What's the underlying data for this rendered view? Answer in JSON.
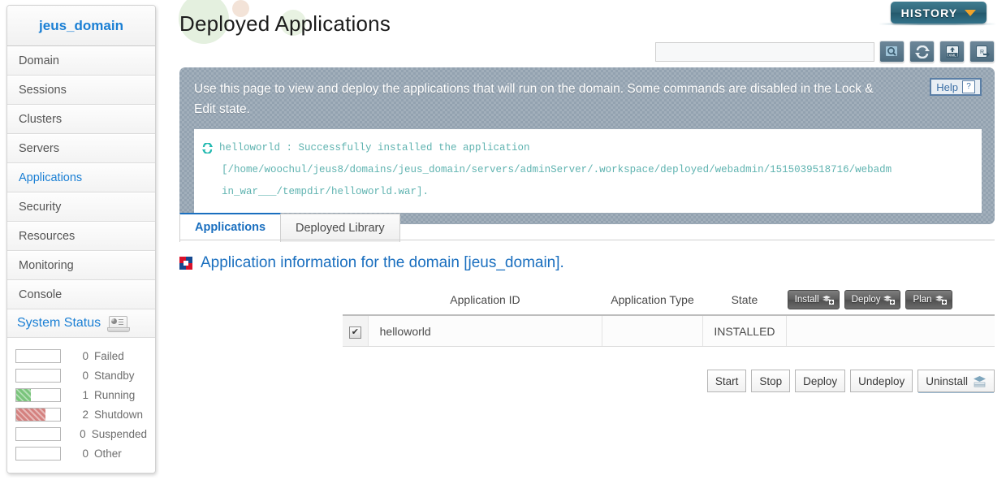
{
  "sidebar": {
    "domain_title": "jeus_domain",
    "items": [
      {
        "label": "Domain"
      },
      {
        "label": "Sessions"
      },
      {
        "label": "Clusters"
      },
      {
        "label": "Servers"
      },
      {
        "label": "Applications"
      },
      {
        "label": "Security"
      },
      {
        "label": "Resources"
      },
      {
        "label": "Monitoring"
      },
      {
        "label": "Console"
      }
    ],
    "system_status": {
      "title": "System Status",
      "icon": "laptop-chart-icon",
      "rows": [
        {
          "count": "0",
          "label": "Failed",
          "fill_pct": 0,
          "color": ""
        },
        {
          "count": "0",
          "label": "Standby",
          "fill_pct": 0,
          "color": ""
        },
        {
          "count": "1",
          "label": "Running",
          "fill_pct": 33,
          "color": "#79c47b"
        },
        {
          "count": "2",
          "label": "Shutdown",
          "fill_pct": 66,
          "color": "#d4817f"
        },
        {
          "count": "0",
          "label": "Suspended",
          "fill_pct": 0,
          "color": ""
        },
        {
          "count": "0",
          "label": "Other",
          "fill_pct": 0,
          "color": ""
        }
      ]
    }
  },
  "header": {
    "page_title": "Deployed Applications",
    "history_label": "HISTORY",
    "history_chevron": "chevron-down-icon",
    "search": {
      "value": "",
      "placeholder": ""
    },
    "toolbar_icons": [
      {
        "name": "search-icon"
      },
      {
        "name": "refresh-icon"
      },
      {
        "name": "xml-export-icon"
      },
      {
        "name": "report-export-icon"
      }
    ]
  },
  "banner": {
    "text": "Use this page to view and deploy the applications that will run on the domain. Some commands are disabled in the Lock & Edit state.",
    "help_label": "Help",
    "help_glyph": "?",
    "message": {
      "icon": "refresh-status-icon",
      "line1": "helloworld : Successfully installed the application",
      "line2": "[/home/woochul/jeus8/domains/jeus_domain/servers/adminServer/.workspace/deployed/webadmin/1515039518716/webadm",
      "line3": "in_war___/tempdir/helloworld.war]."
    }
  },
  "tabs": [
    {
      "label": "Applications",
      "active": true
    },
    {
      "label": "Deployed Library",
      "active": false
    }
  ],
  "section": {
    "icon": "pinwheel-icon",
    "title": "Application information for the domain [jeus_domain]."
  },
  "table": {
    "headers": [
      "",
      "Application ID",
      "Application Type",
      "State",
      ""
    ],
    "header_buttons": [
      {
        "label": "Install",
        "icon": "stack-plus-icon"
      },
      {
        "label": "Deploy",
        "icon": "stack-plus-icon"
      },
      {
        "label": "Plan",
        "icon": "stack-plus-icon"
      }
    ],
    "rows": [
      {
        "checked": true,
        "check_glyph": "✔",
        "app_id": "helloworld",
        "app_type": "",
        "state": "INSTALLED",
        "actions": ""
      }
    ]
  },
  "bottom_buttons": [
    {
      "label": "Start",
      "icon": ""
    },
    {
      "label": "Stop",
      "icon": ""
    },
    {
      "label": "Deploy",
      "icon": ""
    },
    {
      "label": "Undeploy",
      "icon": ""
    },
    {
      "label": "Uninstall",
      "icon": "uninstall-icon"
    }
  ],
  "colors": {
    "accent_blue": "#1a6fbf",
    "banner_bg": "#93a2b0",
    "message_text": "#5fb3b0",
    "history_teal": "#2d6376",
    "history_chevron_orange": "#f0a32a"
  }
}
